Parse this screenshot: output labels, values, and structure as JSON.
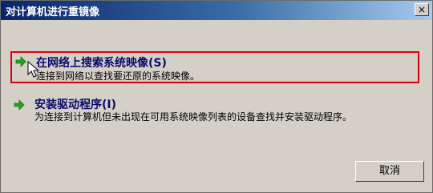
{
  "window": {
    "title": "对计算机进行重镜像",
    "close_label": "×"
  },
  "commands": [
    {
      "title": "在网络上搜索系统映像(S)",
      "description": "连接到网络以查找要还原的系统映像。",
      "icon": "green-arrow-icon",
      "selected": true
    },
    {
      "title": "安装驱动程序(I)",
      "description": "为连接到计算机但未出现在可用系统映像列表的设备查找并安装驱动程序。",
      "icon": "green-arrow-icon",
      "selected": false
    }
  ],
  "buttons": {
    "cancel_label": "取消"
  },
  "colors": {
    "selection_border": "#d9000d",
    "arrow": "#1fa31f",
    "title_text": "#0a0a6a"
  }
}
